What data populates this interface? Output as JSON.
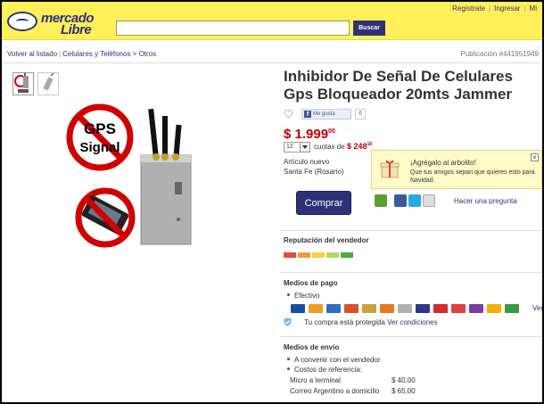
{
  "header": {
    "logo_line1": "mercado",
    "logo_line2": "Libre",
    "search_placeholder": "",
    "search_button": "Buscar",
    "links": [
      "Regístrate",
      "Ingresar",
      "Mi"
    ]
  },
  "breadcrumb": {
    "back": "Volver al listado",
    "path": "Celulares y Teléfonos > Otros"
  },
  "publication": "Publicación #441951949",
  "product": {
    "title": "Inhibidor De Señal De Celulares Gps Bloqueador 20mts Jammer",
    "price_main": "$ 1.999",
    "price_cents": "00",
    "installments_value": "12",
    "installments_text": "cuotas de",
    "installment_amount": "$ 248",
    "installment_cents": "18",
    "condition": "Artículo nuevo",
    "location": "Santa Fe (Rosario)",
    "image_text_line1": "GPS",
    "image_text_line2": "Signal"
  },
  "facebook": {
    "like_label": "Me gusta",
    "count": "0"
  },
  "tooltip": {
    "title": "¡Agrégalo al arbolito!",
    "text": "Que tus amigos sepan que quieres esto para Navidad."
  },
  "actions": {
    "buy": "Comprar",
    "ask": "Hacer una pregunta"
  },
  "reputation": {
    "title": "Reputación del vendedor",
    "colors": [
      "#e24b3b",
      "#f09a3e",
      "#f4d240",
      "#b6d65a",
      "#4aa84a"
    ]
  },
  "payment": {
    "title": "Medios de pago",
    "cash": "Efectivo",
    "protected_text": "Tu compra está protegida",
    "protected_link": "Ver condiciones",
    "more": "Ver",
    "card_colors": [
      "#1a4fa0",
      "#e8a020",
      "#2b6fb8",
      "#d4532a",
      "#c9a23b",
      "#e07b22",
      "#b0b0b0",
      "#2d3a8c",
      "#d12d2d",
      "#e04040",
      "#7a3fa0",
      "#f2b000",
      "#3a9a40"
    ]
  },
  "shipping": {
    "title": "Medios de envío",
    "items": [
      "A convenir con el vendedor",
      "Costos de referencia:"
    ],
    "rows": [
      {
        "label": "Micro a terminal",
        "price": "$ 40,00"
      },
      {
        "label": "Correo Argentino a domicilio",
        "price": "$ 65,00"
      }
    ]
  }
}
